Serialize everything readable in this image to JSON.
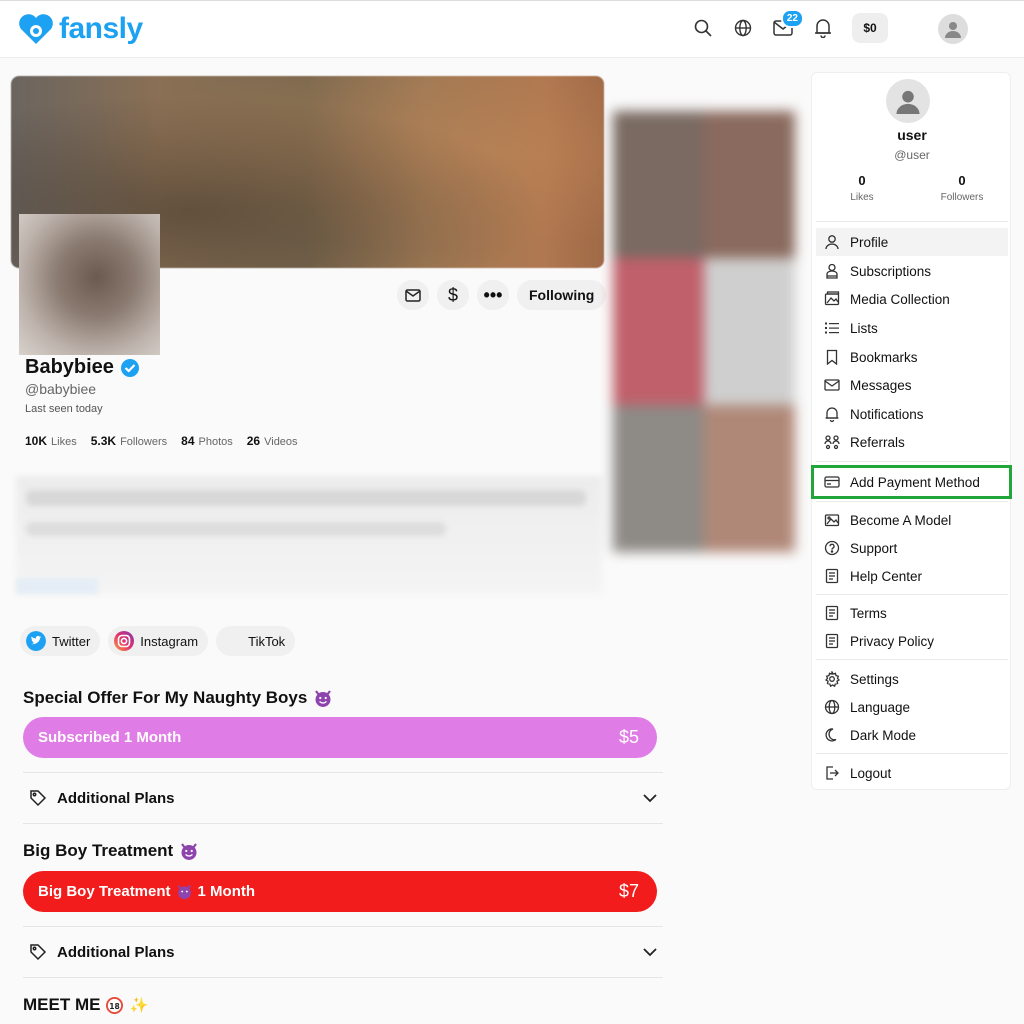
{
  "app": {
    "brand": "fansly"
  },
  "topbar": {
    "messages_badge": "22",
    "wallet": "$0"
  },
  "profile": {
    "name": "Babybiee",
    "handle": "@babybiee",
    "last_seen": "Last seen today",
    "stats": [
      {
        "value": "10K",
        "label": "Likes"
      },
      {
        "value": "5.3K",
        "label": "Followers"
      },
      {
        "value": "84",
        "label": "Photos"
      },
      {
        "value": "26",
        "label": "Videos"
      }
    ],
    "following_label": "Following",
    "socials": [
      {
        "label": "Twitter"
      },
      {
        "label": "Instagram"
      },
      {
        "label": "TikTok"
      }
    ]
  },
  "offers": {
    "offer1_title": "Special Offer For My Naughty Boys",
    "offer1_plan": "Subscribed 1 Month",
    "offer1_price": "$5",
    "additional_plans": "Additional Plans",
    "offer2_title": "Big Boy Treatment",
    "offer2_plan_a": "Big Boy Treatment",
    "offer2_plan_b": "1 Month",
    "offer2_price": "$7",
    "meet_me": "MEET ME"
  },
  "sidebar": {
    "username": "user",
    "handle": "@user",
    "likes_value": "0",
    "likes_label": "Likes",
    "followers_value": "0",
    "followers_label": "Followers",
    "items": [
      {
        "label": "Profile",
        "icon": "person-icon"
      },
      {
        "label": "Subscriptions",
        "icon": "subscriptions-icon"
      },
      {
        "label": "Media Collection",
        "icon": "media-icon"
      },
      {
        "label": "Lists",
        "icon": "list-icon"
      },
      {
        "label": "Bookmarks",
        "icon": "bookmark-icon"
      },
      {
        "label": "Messages",
        "icon": "mail-icon"
      },
      {
        "label": "Notifications",
        "icon": "bell-icon"
      },
      {
        "label": "Referrals",
        "icon": "referrals-icon"
      },
      {
        "label": "Add Payment Method",
        "icon": "card-icon"
      },
      {
        "label": "Become A Model",
        "icon": "model-icon"
      },
      {
        "label": "Support",
        "icon": "help-icon"
      },
      {
        "label": "Help Center",
        "icon": "book-icon"
      },
      {
        "label": "Terms",
        "icon": "document-icon"
      },
      {
        "label": "Privacy Policy",
        "icon": "document-icon"
      },
      {
        "label": "Settings",
        "icon": "gear-icon"
      },
      {
        "label": "Language",
        "icon": "globe-icon"
      },
      {
        "label": "Dark Mode",
        "icon": "moon-icon"
      },
      {
        "label": "Logout",
        "icon": "logout-icon"
      }
    ]
  },
  "colors": {
    "accent": "#1da1f2",
    "pink_plan": "#e07ce6",
    "red_plan": "#f21c1c",
    "highlight": "#22a53a"
  }
}
